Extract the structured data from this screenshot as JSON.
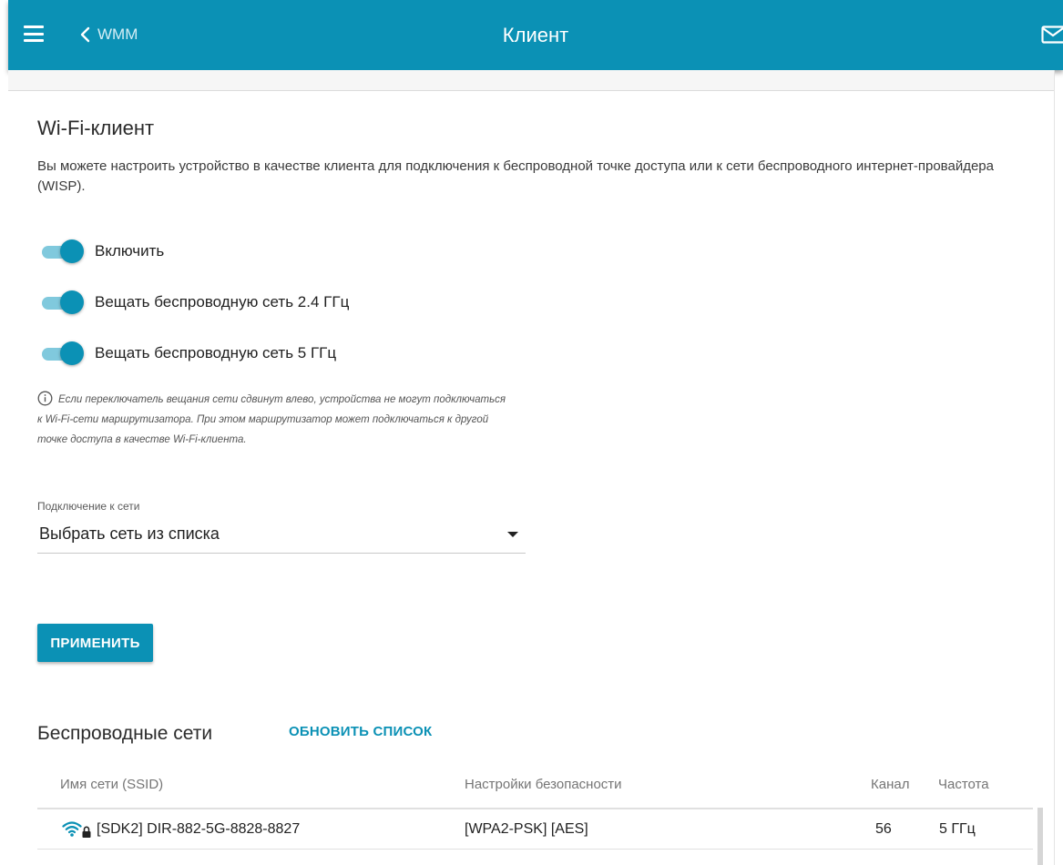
{
  "header": {
    "back_label": "WMM",
    "title": "Клиент"
  },
  "section": {
    "title": "Wi-Fi-клиент",
    "description": "Вы можете настроить устройство в качестве клиента для подключения к беспроводной точке доступа или к сети беспроводного интернет-провайдера (WISP)."
  },
  "toggles": {
    "enable_label": "Включить",
    "broadcast24_label": "Вещать беспроводную сеть 2.4 ГГц",
    "broadcast5_label": "Вещать беспроводную сеть 5 ГГц"
  },
  "hint": "Если переключатель вещания сети сдвинут влево, устройства не могут подключаться к Wi-Fi-сети маршрутизатора. При этом маршрутизатор может подключаться к другой точке доступа в качестве Wi-Fi-клиента.",
  "connection": {
    "label": "Подключение к сети",
    "value": "Выбрать сеть из списка"
  },
  "apply_label": "ПРИМЕНИТЬ",
  "networks": {
    "title": "Беспроводные сети",
    "refresh_label": "ОБНОВИТЬ СПИСОК",
    "columns": {
      "ssid": "Имя сети (SSID)",
      "security": "Настройки безопасности",
      "channel": "Канал",
      "frequency": "Частота"
    },
    "rows": [
      {
        "ssid": "[SDK2] DIR-882-5G-8828-8827",
        "security": "[WPA2-PSK] [AES]",
        "channel": "56",
        "frequency": "5 ГГц"
      }
    ]
  },
  "colors": {
    "accent": "#0b91b5",
    "toggle_track": "#80c9dd"
  },
  "icons": [
    "menu-icon",
    "chevron-left-icon",
    "mail-icon",
    "info-icon",
    "caret-down-icon",
    "wifi-lock-icon"
  ]
}
